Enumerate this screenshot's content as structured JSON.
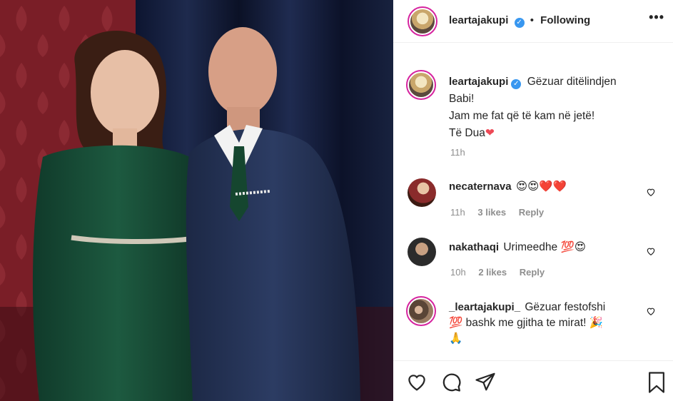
{
  "post": {
    "username": "leartajakupi",
    "follow_state": "Following",
    "more_label": "•••",
    "caption_lines": [
      "Gëzuar ditëlindjen",
      "Babi!",
      "Jam me fat që të kam në jetë!",
      "Të Dua"
    ],
    "caption_time": "11h"
  },
  "comments": [
    {
      "username": "necaternava",
      "text": "😍😍❤️❤️",
      "time": "11h",
      "likes": "3 likes",
      "reply": "Reply"
    },
    {
      "username": "nakathaqi",
      "text": "Urimeedhe 💯😍",
      "time": "10h",
      "likes": "2 likes",
      "reply": "Reply"
    },
    {
      "username": "_leartajakupi_",
      "text_line1": "Gëzuar festofshi",
      "text_line2": "💯 bashk me gjitha te mirat! 🎉",
      "text_line3": "🙏"
    }
  ],
  "icons": {
    "like": "heart-icon",
    "comment": "comment-icon",
    "share": "paper-plane-icon",
    "save": "bookmark-icon",
    "verified": "verified-badge-icon"
  },
  "colors": {
    "accent": "#3897f0",
    "story_ring": "#d6249f",
    "muted_text": "#8e8e8e",
    "heart_red": "#ed4956"
  }
}
